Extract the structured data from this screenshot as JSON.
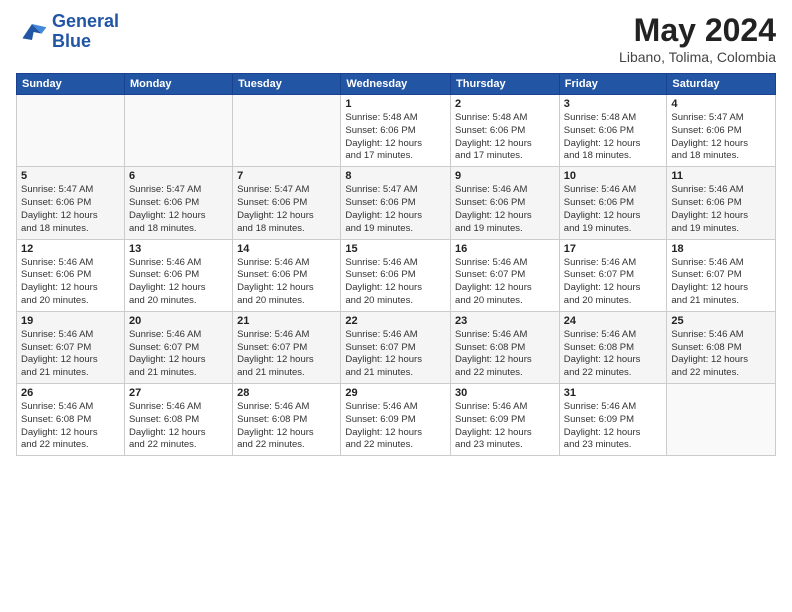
{
  "logo": {
    "line1": "General",
    "line2": "Blue"
  },
  "title": {
    "month_year": "May 2024",
    "location": "Libano, Tolima, Colombia"
  },
  "weekdays": [
    "Sunday",
    "Monday",
    "Tuesday",
    "Wednesday",
    "Thursday",
    "Friday",
    "Saturday"
  ],
  "weeks": [
    [
      {
        "day": "",
        "info": ""
      },
      {
        "day": "",
        "info": ""
      },
      {
        "day": "",
        "info": ""
      },
      {
        "day": "1",
        "info": "Sunrise: 5:48 AM\nSunset: 6:06 PM\nDaylight: 12 hours\nand 17 minutes."
      },
      {
        "day": "2",
        "info": "Sunrise: 5:48 AM\nSunset: 6:06 PM\nDaylight: 12 hours\nand 17 minutes."
      },
      {
        "day": "3",
        "info": "Sunrise: 5:48 AM\nSunset: 6:06 PM\nDaylight: 12 hours\nand 18 minutes."
      },
      {
        "day": "4",
        "info": "Sunrise: 5:47 AM\nSunset: 6:06 PM\nDaylight: 12 hours\nand 18 minutes."
      }
    ],
    [
      {
        "day": "5",
        "info": "Sunrise: 5:47 AM\nSunset: 6:06 PM\nDaylight: 12 hours\nand 18 minutes."
      },
      {
        "day": "6",
        "info": "Sunrise: 5:47 AM\nSunset: 6:06 PM\nDaylight: 12 hours\nand 18 minutes."
      },
      {
        "day": "7",
        "info": "Sunrise: 5:47 AM\nSunset: 6:06 PM\nDaylight: 12 hours\nand 18 minutes."
      },
      {
        "day": "8",
        "info": "Sunrise: 5:47 AM\nSunset: 6:06 PM\nDaylight: 12 hours\nand 19 minutes."
      },
      {
        "day": "9",
        "info": "Sunrise: 5:46 AM\nSunset: 6:06 PM\nDaylight: 12 hours\nand 19 minutes."
      },
      {
        "day": "10",
        "info": "Sunrise: 5:46 AM\nSunset: 6:06 PM\nDaylight: 12 hours\nand 19 minutes."
      },
      {
        "day": "11",
        "info": "Sunrise: 5:46 AM\nSunset: 6:06 PM\nDaylight: 12 hours\nand 19 minutes."
      }
    ],
    [
      {
        "day": "12",
        "info": "Sunrise: 5:46 AM\nSunset: 6:06 PM\nDaylight: 12 hours\nand 20 minutes."
      },
      {
        "day": "13",
        "info": "Sunrise: 5:46 AM\nSunset: 6:06 PM\nDaylight: 12 hours\nand 20 minutes."
      },
      {
        "day": "14",
        "info": "Sunrise: 5:46 AM\nSunset: 6:06 PM\nDaylight: 12 hours\nand 20 minutes."
      },
      {
        "day": "15",
        "info": "Sunrise: 5:46 AM\nSunset: 6:06 PM\nDaylight: 12 hours\nand 20 minutes."
      },
      {
        "day": "16",
        "info": "Sunrise: 5:46 AM\nSunset: 6:07 PM\nDaylight: 12 hours\nand 20 minutes."
      },
      {
        "day": "17",
        "info": "Sunrise: 5:46 AM\nSunset: 6:07 PM\nDaylight: 12 hours\nand 20 minutes."
      },
      {
        "day": "18",
        "info": "Sunrise: 5:46 AM\nSunset: 6:07 PM\nDaylight: 12 hours\nand 21 minutes."
      }
    ],
    [
      {
        "day": "19",
        "info": "Sunrise: 5:46 AM\nSunset: 6:07 PM\nDaylight: 12 hours\nand 21 minutes."
      },
      {
        "day": "20",
        "info": "Sunrise: 5:46 AM\nSunset: 6:07 PM\nDaylight: 12 hours\nand 21 minutes."
      },
      {
        "day": "21",
        "info": "Sunrise: 5:46 AM\nSunset: 6:07 PM\nDaylight: 12 hours\nand 21 minutes."
      },
      {
        "day": "22",
        "info": "Sunrise: 5:46 AM\nSunset: 6:07 PM\nDaylight: 12 hours\nand 21 minutes."
      },
      {
        "day": "23",
        "info": "Sunrise: 5:46 AM\nSunset: 6:08 PM\nDaylight: 12 hours\nand 22 minutes."
      },
      {
        "day": "24",
        "info": "Sunrise: 5:46 AM\nSunset: 6:08 PM\nDaylight: 12 hours\nand 22 minutes."
      },
      {
        "day": "25",
        "info": "Sunrise: 5:46 AM\nSunset: 6:08 PM\nDaylight: 12 hours\nand 22 minutes."
      }
    ],
    [
      {
        "day": "26",
        "info": "Sunrise: 5:46 AM\nSunset: 6:08 PM\nDaylight: 12 hours\nand 22 minutes."
      },
      {
        "day": "27",
        "info": "Sunrise: 5:46 AM\nSunset: 6:08 PM\nDaylight: 12 hours\nand 22 minutes."
      },
      {
        "day": "28",
        "info": "Sunrise: 5:46 AM\nSunset: 6:08 PM\nDaylight: 12 hours\nand 22 minutes."
      },
      {
        "day": "29",
        "info": "Sunrise: 5:46 AM\nSunset: 6:09 PM\nDaylight: 12 hours\nand 22 minutes."
      },
      {
        "day": "30",
        "info": "Sunrise: 5:46 AM\nSunset: 6:09 PM\nDaylight: 12 hours\nand 23 minutes."
      },
      {
        "day": "31",
        "info": "Sunrise: 5:46 AM\nSunset: 6:09 PM\nDaylight: 12 hours\nand 23 minutes."
      },
      {
        "day": "",
        "info": ""
      }
    ]
  ]
}
